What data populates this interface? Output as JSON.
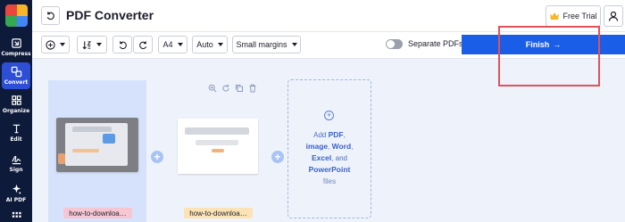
{
  "app": {
    "title": "PDF Converter"
  },
  "header": {
    "free_trial_label": "Free Trial"
  },
  "sidebar": {
    "items": [
      {
        "label": "Compress",
        "icon": "compress-icon",
        "active": false
      },
      {
        "label": "Convert",
        "icon": "convert-icon",
        "active": true
      },
      {
        "label": "Organize",
        "icon": "organize-icon",
        "active": false
      },
      {
        "label": "Edit",
        "icon": "edit-icon",
        "active": false
      },
      {
        "label": "Sign",
        "icon": "sign-icon",
        "active": false
      },
      {
        "label": "AI PDF",
        "icon": "ai-pdf-icon",
        "active": false
      }
    ]
  },
  "toolbar": {
    "page_size": "A4",
    "orientation": "Auto",
    "margins": "Small margins",
    "separate_pdfs_label": "Separate PDFs",
    "finish_label": "Finish",
    "finish_arrow": "→"
  },
  "files": [
    {
      "name": "how-to-downloa…",
      "badge_color": "#f6c7d3"
    },
    {
      "name": "how-to-downloa…",
      "badge_color": "#fbe3b6"
    }
  ],
  "add_files": {
    "prefix": "Add",
    "pdf": "PDF",
    "comma1": ",",
    "image": "image",
    "comma2": ",",
    "word": "Word",
    "comma3": ",",
    "excel": "Excel",
    "and": ", and",
    "powerpoint": "PowerPoint",
    "suffix": "files"
  },
  "colors": {
    "accent": "#1a5de6",
    "sidebar": "#0e1a3a",
    "highlight_box": "#e0525a"
  }
}
